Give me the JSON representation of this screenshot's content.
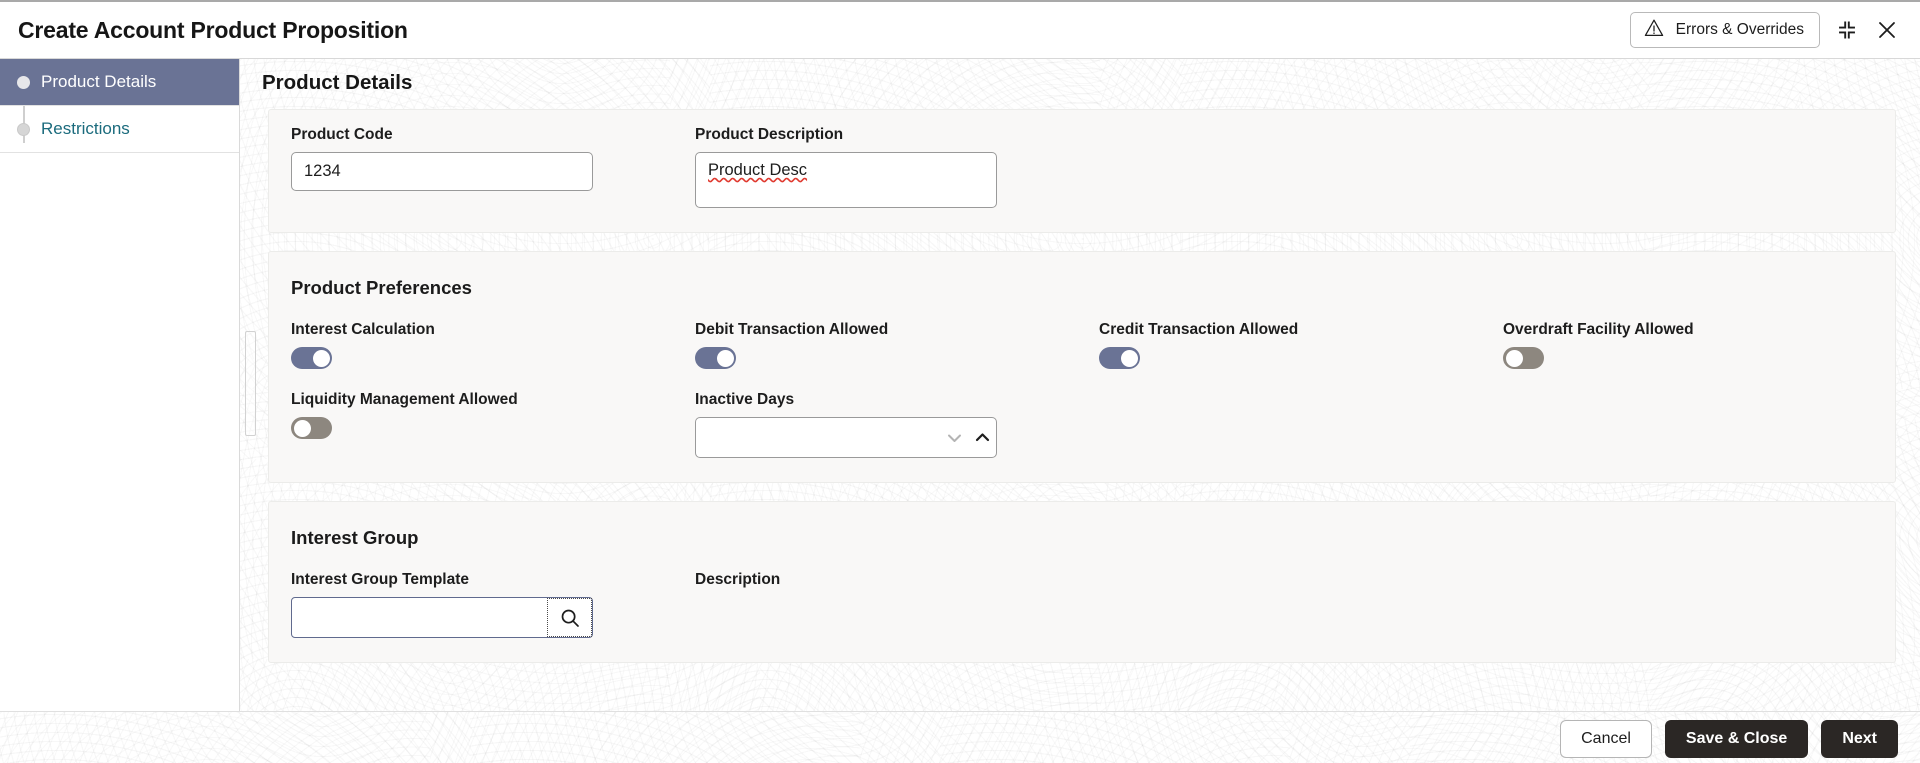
{
  "window": {
    "title": "Create Account Product Proposition",
    "errors_overrides_label": "Errors & Overrides",
    "minimize_icon": "collapse-icon",
    "close_icon": "close-icon",
    "warning_icon": "warning-triangle-icon"
  },
  "sidebar": {
    "items": [
      {
        "label": "Product Details",
        "active": true
      },
      {
        "label": "Restrictions",
        "active": false
      }
    ]
  },
  "main": {
    "section_title": "Product Details",
    "product_details": {
      "product_code": {
        "label": "Product Code",
        "value": "1234",
        "placeholder": ""
      },
      "product_description": {
        "label": "Product Description",
        "value": "Product Desc",
        "placeholder": ""
      }
    },
    "product_preferences": {
      "title": "Product Preferences",
      "toggles": [
        {
          "label": "Interest Calculation",
          "state": "on"
        },
        {
          "label": "Debit Transaction Allowed",
          "state": "on"
        },
        {
          "label": "Credit Transaction Allowed",
          "state": "on"
        },
        {
          "label": "Overdraft Facility Allowed",
          "state": "off"
        },
        {
          "label": "Liquidity Management Allowed",
          "state": "off"
        }
      ],
      "inactive_days": {
        "label": "Inactive Days",
        "value": "",
        "placeholder": ""
      }
    },
    "interest_group": {
      "title": "Interest Group",
      "template": {
        "label": "Interest Group Template",
        "value": "",
        "placeholder": "",
        "search_icon": "search-icon"
      },
      "description": {
        "label": "Description",
        "value": ""
      }
    }
  },
  "footer": {
    "cancel_label": "Cancel",
    "save_close_label": "Save & Close",
    "next_label": "Next"
  },
  "colors": {
    "accent_toggle_on": "#6a7395",
    "toggle_off": "#8d877f",
    "sidebar_active_bg": "#6a7395",
    "link": "#1b6b7d",
    "button_dark": "#2b2725"
  }
}
